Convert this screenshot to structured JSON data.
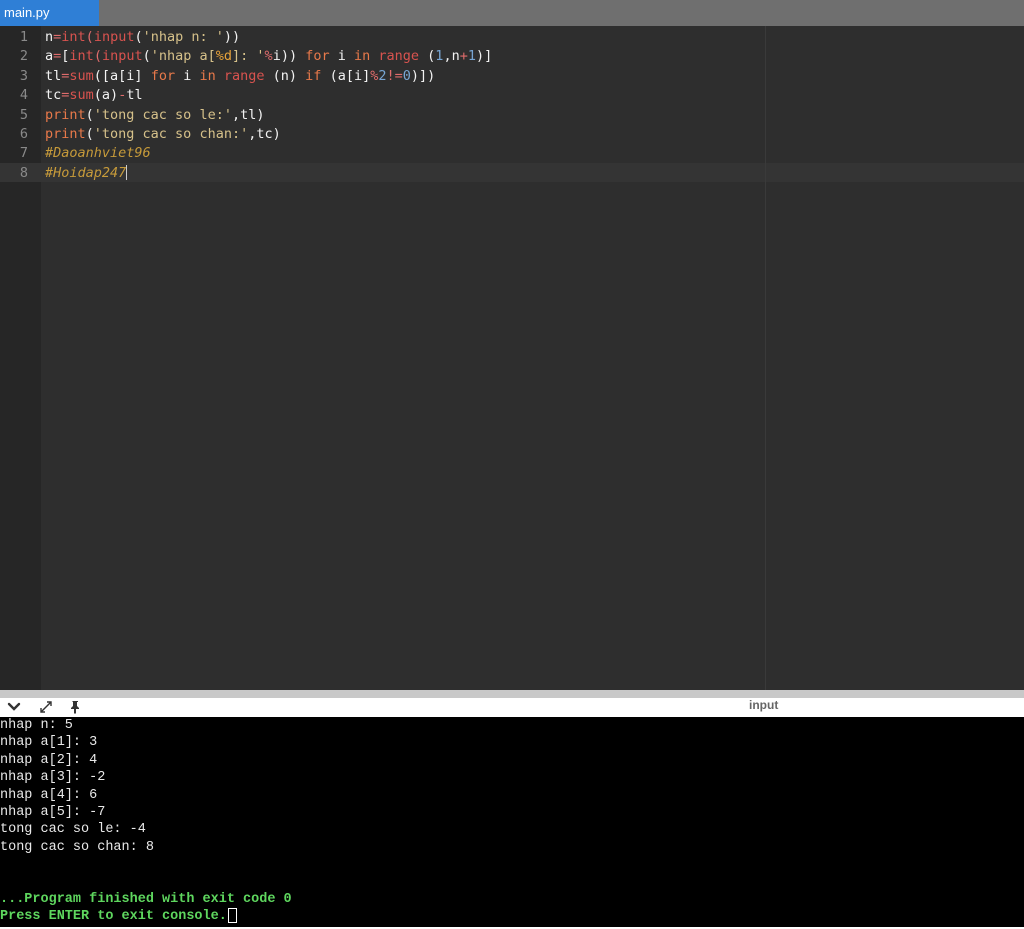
{
  "tab": {
    "title": "main.py"
  },
  "editor": {
    "lines": [
      {
        "num": "1",
        "tokens": [
          {
            "t": "n",
            "c": "id"
          },
          {
            "t": "=",
            "c": "op"
          },
          {
            "t": "int",
            "c": "bi"
          },
          {
            "t": "(",
            "c": "op"
          },
          {
            "t": "input",
            "c": "bi"
          },
          {
            "t": "(",
            "c": "id"
          },
          {
            "t": "'nhap n: '",
            "c": "str"
          },
          {
            "t": "))",
            "c": "id"
          }
        ]
      },
      {
        "num": "2",
        "tokens": [
          {
            "t": "a",
            "c": "id"
          },
          {
            "t": "=",
            "c": "op"
          },
          {
            "t": "[",
            "c": "id"
          },
          {
            "t": "int",
            "c": "bi"
          },
          {
            "t": "(",
            "c": "op"
          },
          {
            "t": "input",
            "c": "bi"
          },
          {
            "t": "(",
            "c": "id"
          },
          {
            "t": "'nhap a[",
            "c": "str"
          },
          {
            "t": "%d",
            "c": "fmt"
          },
          {
            "t": "]: '",
            "c": "str"
          },
          {
            "t": "%",
            "c": "op"
          },
          {
            "t": "i)) ",
            "c": "id"
          },
          {
            "t": "for",
            "c": "kw"
          },
          {
            "t": " i ",
            "c": "id"
          },
          {
            "t": "in",
            "c": "kw"
          },
          {
            "t": " ",
            "c": "id"
          },
          {
            "t": "range",
            "c": "bi"
          },
          {
            "t": " (",
            "c": "id"
          },
          {
            "t": "1",
            "c": "num"
          },
          {
            "t": ",n",
            "c": "id"
          },
          {
            "t": "+",
            "c": "op"
          },
          {
            "t": "1",
            "c": "num"
          },
          {
            "t": ")]",
            "c": "id"
          }
        ]
      },
      {
        "num": "3",
        "tokens": [
          {
            "t": "tl",
            "c": "id"
          },
          {
            "t": "=",
            "c": "op"
          },
          {
            "t": "sum",
            "c": "bi"
          },
          {
            "t": "([a[i] ",
            "c": "id"
          },
          {
            "t": "for",
            "c": "kw"
          },
          {
            "t": " i ",
            "c": "id"
          },
          {
            "t": "in",
            "c": "kw"
          },
          {
            "t": " ",
            "c": "id"
          },
          {
            "t": "range",
            "c": "bi"
          },
          {
            "t": " (n) ",
            "c": "id"
          },
          {
            "t": "if",
            "c": "kw"
          },
          {
            "t": " (a[i]",
            "c": "id"
          },
          {
            "t": "%",
            "c": "op"
          },
          {
            "t": "2",
            "c": "num"
          },
          {
            "t": "!=",
            "c": "op"
          },
          {
            "t": "0",
            "c": "num"
          },
          {
            "t": ")])",
            "c": "id"
          }
        ]
      },
      {
        "num": "4",
        "tokens": [
          {
            "t": "tc",
            "c": "id"
          },
          {
            "t": "=",
            "c": "op"
          },
          {
            "t": "sum",
            "c": "bi"
          },
          {
            "t": "(a)",
            "c": "id"
          },
          {
            "t": "-",
            "c": "op"
          },
          {
            "t": "tl",
            "c": "id"
          }
        ]
      },
      {
        "num": "5",
        "tokens": [
          {
            "t": "print",
            "c": "kw"
          },
          {
            "t": "(",
            "c": "id"
          },
          {
            "t": "'tong cac so le:'",
            "c": "str"
          },
          {
            "t": ",tl)",
            "c": "id"
          }
        ]
      },
      {
        "num": "6",
        "tokens": [
          {
            "t": "print",
            "c": "kw"
          },
          {
            "t": "(",
            "c": "id"
          },
          {
            "t": "'tong cac so chan:'",
            "c": "str"
          },
          {
            "t": ",tc)",
            "c": "id"
          }
        ]
      },
      {
        "num": "7",
        "tokens": [
          {
            "t": "#Daoanhviet96",
            "c": "cm"
          }
        ]
      },
      {
        "num": "8",
        "tokens": [
          {
            "t": "#Hoidap247",
            "c": "cm"
          }
        ],
        "cursor": true
      }
    ]
  },
  "console_toolbar": {
    "icons": [
      "chevron-down-icon",
      "expand-icon",
      "pin-icon"
    ],
    "input_label": "input"
  },
  "console": {
    "output": [
      "nhap n: 5",
      "nhap a[1]: 3",
      "nhap a[2]: 4",
      "nhap a[3]: -2",
      "nhap a[4]: 6",
      "nhap a[5]: -7",
      "tong cac so le: -4",
      "tong cac so chan: 8"
    ],
    "status": [
      "...Program finished with exit code 0",
      "Press ENTER to exit console."
    ]
  },
  "colors": {
    "tab_active": "#2f7fd6",
    "editor_bg": "#2e2e2e",
    "console_bg": "#000000",
    "console_green": "#5ed65e"
  }
}
